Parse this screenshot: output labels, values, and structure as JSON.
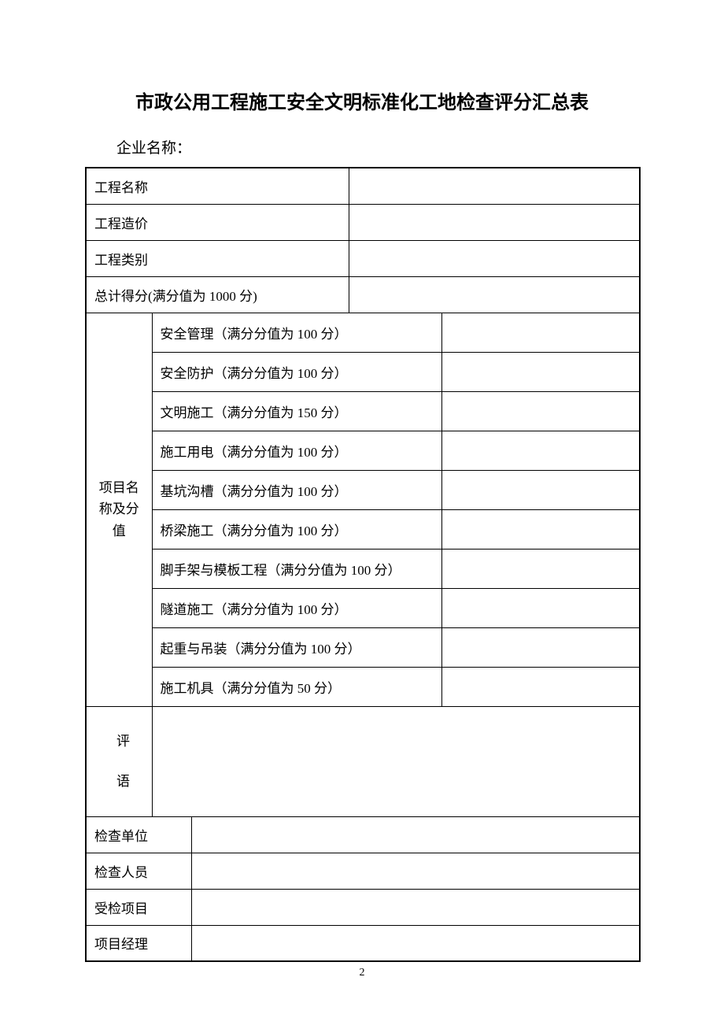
{
  "title": "市政公用工程施工安全文明标准化工地检查评分汇总表",
  "subtitle": "企业名称：",
  "rows": {
    "project_name": "工程名称",
    "project_cost": "工程造价",
    "project_type": "工程类别",
    "total_score": "总计得分(满分值为 1000 分)"
  },
  "category_header": "项目名称及分值",
  "categories": [
    "安全管理（满分分值为 100 分）",
    "安全防护（满分分值为 100 分）",
    "文明施工（满分分值为 150 分）",
    "施工用电（满分分值为 100 分）",
    "基坑沟槽（满分分值为 100 分）",
    "桥梁施工（满分分值为 100 分）",
    "脚手架与模板工程（满分分值为 100 分）",
    "隧道施工（满分分值为 100 分）",
    "起重与吊装（满分分值为 100 分）",
    "施工机具（满分分值为 50 分）"
  ],
  "comment_label": "评语",
  "footer": {
    "inspect_unit": "检查单位",
    "inspectors": "检查人员",
    "inspected_project": "受检项目",
    "project_manager": "项目经理"
  },
  "page_number": "2"
}
